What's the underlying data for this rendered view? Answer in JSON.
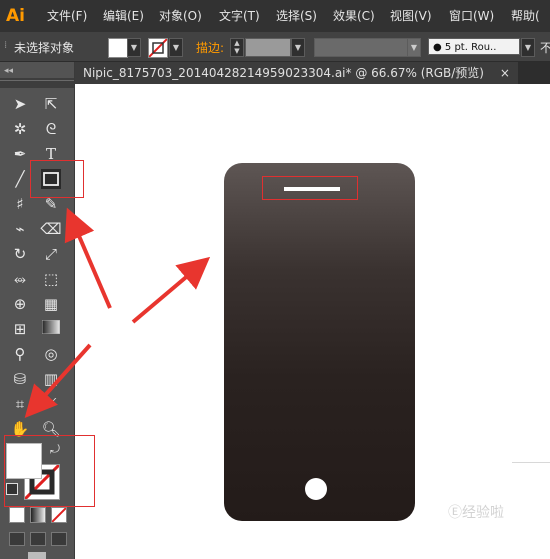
{
  "app": {
    "logo": "Ai"
  },
  "menu": [
    "文件(F)",
    "编辑(E)",
    "对象(O)",
    "文字(T)",
    "选择(S)",
    "效果(C)",
    "视图(V)",
    "窗口(W)",
    "帮助("
  ],
  "control": {
    "selection": "未选择对象",
    "stroke_label": "描边:",
    "brush": "● 5 pt. Rou..",
    "right_cut": "不"
  },
  "document": {
    "tab_title": "Nipic_8175703_20140428214959023304.ai*  @  66.67%  (RGB/预览)",
    "close": "×"
  },
  "watermark": "经验啦",
  "colors": {
    "accent": "#ff9a00",
    "annotation": "#e03030",
    "phone": "#231b19"
  }
}
